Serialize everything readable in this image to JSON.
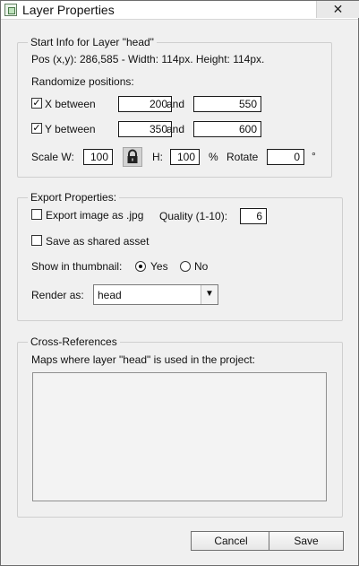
{
  "window": {
    "title": "Layer Properties",
    "close_glyph": "✕"
  },
  "start_info": {
    "legend": "Start Info for Layer \"head\"",
    "pos_line": "Pos (x,y): 286,585 - Width: 114px. Height: 114px.",
    "randomize_label": "Randomize positions:",
    "x_label": "X between",
    "x_checked": true,
    "x_min": "200",
    "x_and": "and",
    "x_max": "550",
    "y_label": "Y between",
    "y_checked": true,
    "y_min": "350",
    "y_and": "and",
    "y_max": "600",
    "scale_w_label": "Scale W:",
    "scale_w": "100",
    "lock_icon": "lock-icon",
    "h_label": "H:",
    "scale_h": "100",
    "percent": "%",
    "rotate_label": "Rotate",
    "rotate": "0",
    "degree": "°"
  },
  "export": {
    "legend": "Export Properties:",
    "export_jpg_label": "Export image as .jpg",
    "export_jpg_checked": false,
    "quality_label": "Quality (1-10):",
    "quality": "6",
    "shared_label": "Save as shared asset",
    "shared_checked": false,
    "thumb_label": "Show in thumbnail:",
    "yes_label": "Yes",
    "no_label": "No",
    "thumb_selected": "Yes",
    "render_label": "Render as:",
    "render_value": "head"
  },
  "cross_refs": {
    "legend": "Cross-References",
    "desc": "Maps where layer \"head\" is used in the project:",
    "items": []
  },
  "footer": {
    "cancel_label": "Cancel",
    "save_label": "Save"
  }
}
